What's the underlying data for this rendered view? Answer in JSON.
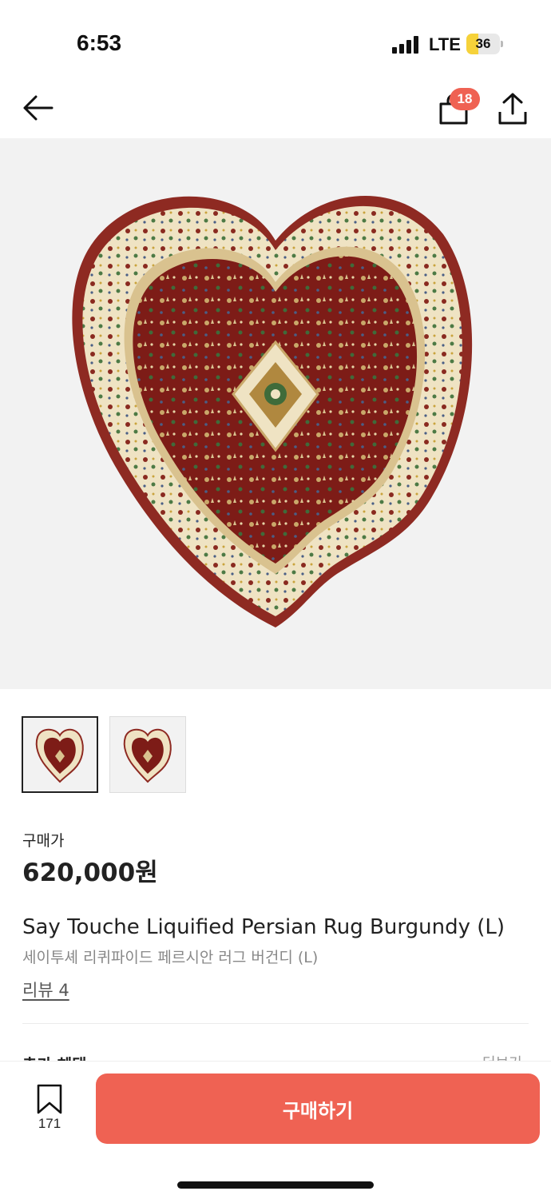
{
  "status_bar": {
    "time": "6:53",
    "network": "LTE",
    "battery_level": "36",
    "battery_color": "#f6d23a"
  },
  "nav": {
    "back_icon": "arrow-left-icon",
    "bag_icon": "shopping-bag-icon",
    "bag_badge": "18",
    "share_icon": "share-icon"
  },
  "product": {
    "image_icon": "heart-rug-image",
    "thumbnails": [
      "heart-rug-thumb-1",
      "heart-rug-thumb-2"
    ],
    "price_label": "구매가",
    "price": "620,000원",
    "title_en": "Say Touche Liquified Persian Rug Burgundy (L)",
    "title_ko": "세이투셰 리퀴파이드 페르시안 러그 버건디 (L)",
    "review_link": "리뷰 4"
  },
  "peek": {
    "section_title": "추가 혜택",
    "more_link": "더보기"
  },
  "bottom_bar": {
    "wish_icon": "bookmark-icon",
    "wish_count": "171",
    "buy_label": "구매하기"
  },
  "colors": {
    "accent": "#ef6253",
    "rug_burgundy": "#7d1c17",
    "rug_border": "#efe3c3"
  }
}
